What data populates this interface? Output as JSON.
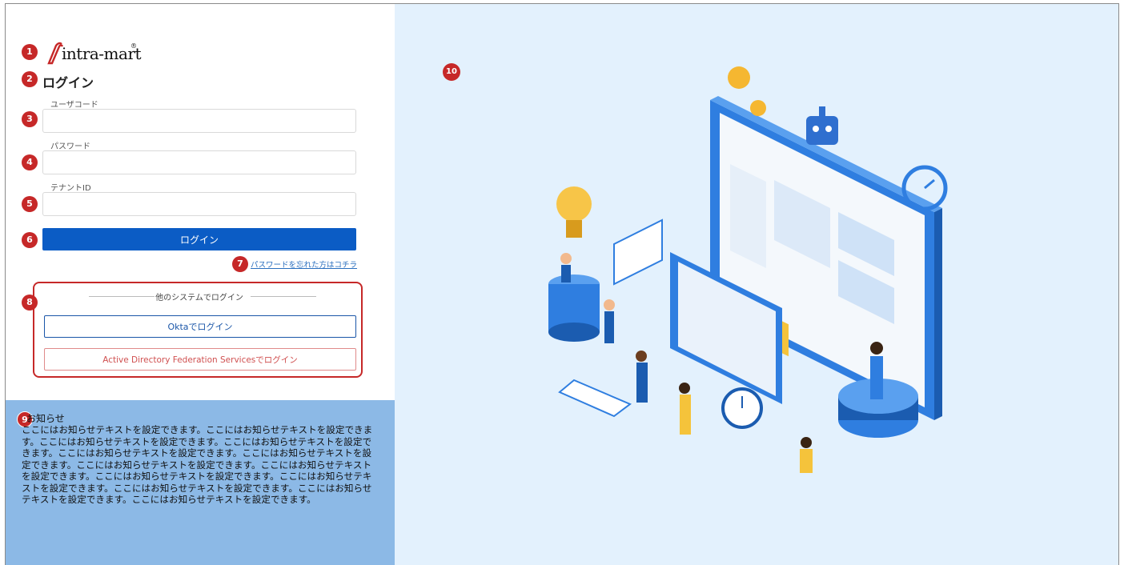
{
  "brand": {
    "logo_text": "intra-mart",
    "logo_mark": "®"
  },
  "page": {
    "title": "ログイン"
  },
  "form": {
    "user_code_label": "ユーザコード",
    "user_code_value": "",
    "password_label": "パスワード",
    "password_value": "",
    "tenant_label": "テナントID",
    "tenant_value": "",
    "login_button": "ログイン",
    "forgot_link": "パスワードを忘れた方はコチラ"
  },
  "other_login": {
    "title": "他のシステムでログイン",
    "okta_button": "Oktaでログイン",
    "adfs_button": "Active Directory Federation Servicesでログイン"
  },
  "notice": {
    "title": "お知らせ",
    "body": "ここにはお知らせテキストを設定できます。ここにはお知らせテキストを設定できます。ここにはお知らせテキストを設定できます。ここにはお知らせテキストを設定できます。ここにはお知らせテキストを設定できます。ここにはお知らせテキストを設定できます。ここにはお知らせテキストを設定できます。ここにはお知らせテキストを設定できます。ここにはお知らせテキストを設定できます。ここにはお知らせテキストを設定できます。ここにはお知らせテキストを設定できます。ここにはお知らせテキストを設定できます。ここにはお知らせテキストを設定できます。"
  },
  "badges": [
    "1",
    "2",
    "3",
    "4",
    "5",
    "6",
    "7",
    "8",
    "9",
    "10"
  ],
  "colors": {
    "primary": "#0b5cc5",
    "badge": "#c62828",
    "notice_bg": "#8cb9e6",
    "illustration_bg": "#e3f1fd"
  }
}
